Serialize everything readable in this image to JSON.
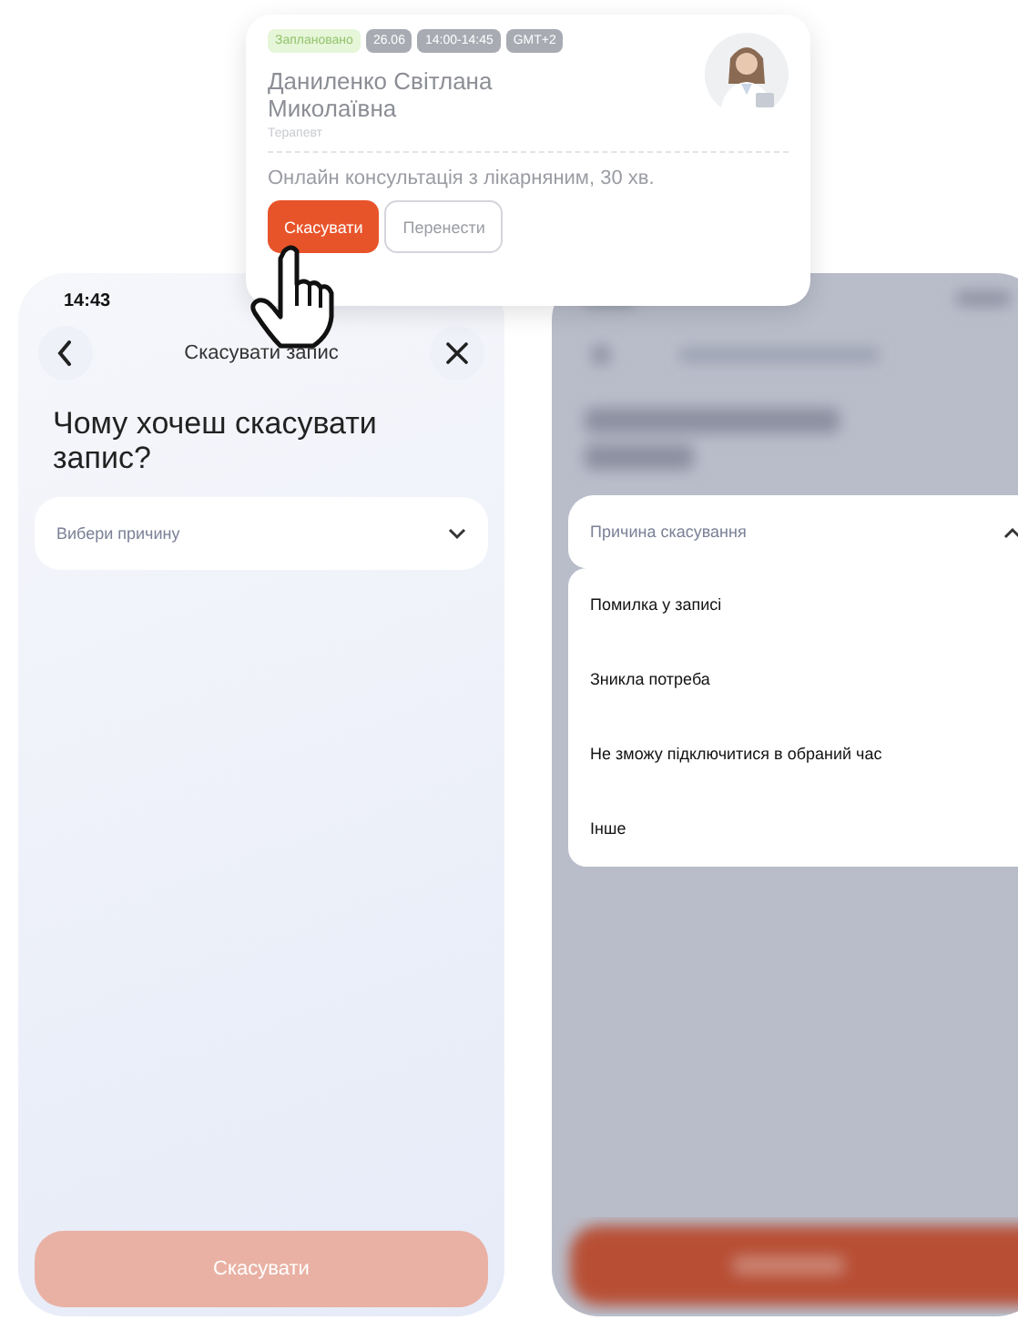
{
  "card": {
    "tags": [
      {
        "label": "Заплановано",
        "kind": "status"
      },
      {
        "label": "26.06",
        "kind": "info"
      },
      {
        "label": "14:00-14:45",
        "kind": "info"
      },
      {
        "label": "GMT+2",
        "kind": "info"
      }
    ],
    "doctor_name": "Даниленко Світлана Миколаївна",
    "specialty": "Терапевт",
    "service": "Онлайн консультація з лікарняним, 30 хв.",
    "buttons": [
      {
        "label": "Скасувати",
        "kind": "primary"
      },
      {
        "label": "Перенести",
        "kind": "secondary"
      }
    ]
  },
  "left_screen": {
    "time": "14:43",
    "title": "Скасувати запис",
    "heading": "Чому хочеш скасувати запис?",
    "select": {
      "placeholder": "Вибери причину",
      "expanded": false
    },
    "button": {
      "label": "Скасувати",
      "disabled": true
    }
  },
  "right_screen": {
    "select": {
      "placeholder": "Причина скасування",
      "expanded": true
    },
    "options": [
      "Помилка у записі",
      "Зникла потреба",
      "Не зможу підключитися в обраний час",
      "Інше"
    ]
  }
}
